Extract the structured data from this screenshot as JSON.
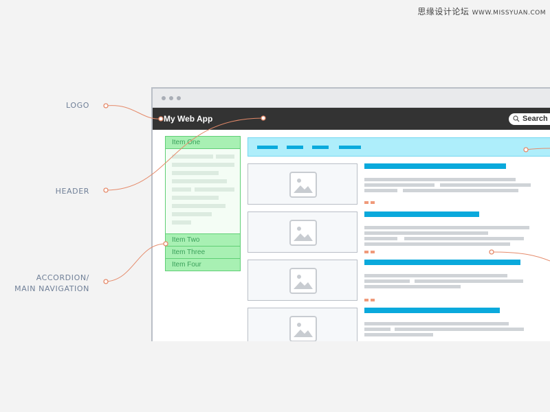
{
  "watermark": {
    "text": "思缘设计论坛",
    "site": "WWW.MISSYUAN.COM"
  },
  "callouts": {
    "logo": "LOGO",
    "header": "HEADER",
    "accordion_line1": "ACCORDION/",
    "accordion_line2": "MAIN NAVIGATION"
  },
  "app": {
    "title": "My Web App",
    "search_label": "Search"
  },
  "accordion": {
    "items": [
      "Item One",
      "Item Two",
      "Item Three",
      "Item Four"
    ]
  },
  "colors": {
    "accent": "#0aa9dc",
    "nav_bg": "#aeeefb",
    "accordion_bg": "#a8f0b3",
    "accordion_border": "#5fcf75",
    "connector": "#e58a6a",
    "header_bg": "#333333"
  },
  "icons": [
    "search-icon",
    "image-placeholder-icon",
    "browser-dot-icon"
  ]
}
